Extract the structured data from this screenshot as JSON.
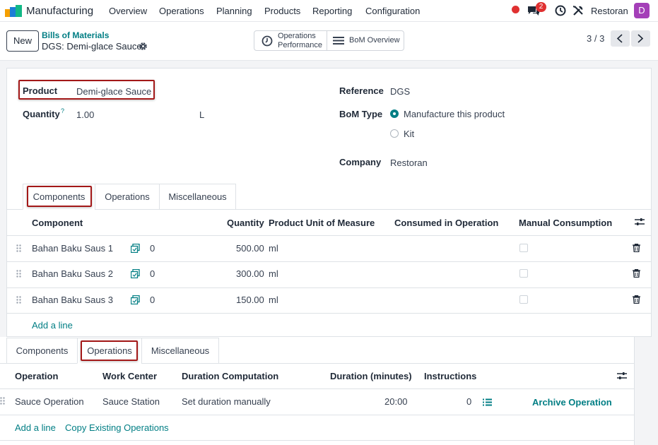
{
  "navbar": {
    "app_name": "Manufacturing",
    "menu": [
      "Overview",
      "Operations",
      "Planning",
      "Products",
      "Reporting",
      "Configuration"
    ],
    "chat_count": "2",
    "company": "Restoran",
    "avatar_letter": "D"
  },
  "control": {
    "new_label": "New",
    "breadcrumb_parent": "Bills of Materials",
    "breadcrumb_current": "DGS: Demi-glace Sauce",
    "stat_operations": "Operations Performance",
    "stat_bom": "BoM Overview",
    "pager": "3 / 3"
  },
  "form": {
    "product_label": "Product",
    "product_value": "Demi-glace Sauce",
    "quantity_label": "Quantity",
    "quantity_help": "?",
    "quantity_value": "1.00",
    "quantity_uom": "L",
    "reference_label": "Reference",
    "reference_value": "DGS",
    "bom_type_label": "BoM Type",
    "bom_type_options": [
      "Manufacture this product",
      "Kit"
    ],
    "company_label": "Company",
    "company_value": "Restoran"
  },
  "tabs": [
    "Components",
    "Operations",
    "Miscellaneous"
  ],
  "components": {
    "headers": [
      "Component",
      "Quantity",
      "Product Unit of Measure",
      "Consumed in Operation",
      "Manual Consumption"
    ],
    "rows": [
      {
        "name": "Bahan Baku Saus 1",
        "forecast": "0",
        "qty": "500.00",
        "uom": "ml"
      },
      {
        "name": "Bahan Baku Saus 2",
        "forecast": "0",
        "qty": "300.00",
        "uom": "ml"
      },
      {
        "name": "Bahan Baku Saus 3",
        "forecast": "0",
        "qty": "150.00",
        "uom": "ml"
      }
    ],
    "add_line": "Add a line"
  },
  "operations": {
    "headers": [
      "Operation",
      "Work Center",
      "Duration Computation",
      "Duration (minutes)",
      "Instructions"
    ],
    "rows": [
      {
        "name": "Sauce Operation",
        "workcenter": "Sauce Station",
        "computation": "Set duration manually",
        "duration": "20:00",
        "instructions": "0",
        "archive": "Archive Operation"
      }
    ],
    "add_line": "Add a line",
    "copy_existing": "Copy Existing Operations"
  },
  "colors": {
    "accent": "#017e84",
    "highlight": "#a31818",
    "avatar": "#a43fb8",
    "badge": "#e03131"
  }
}
